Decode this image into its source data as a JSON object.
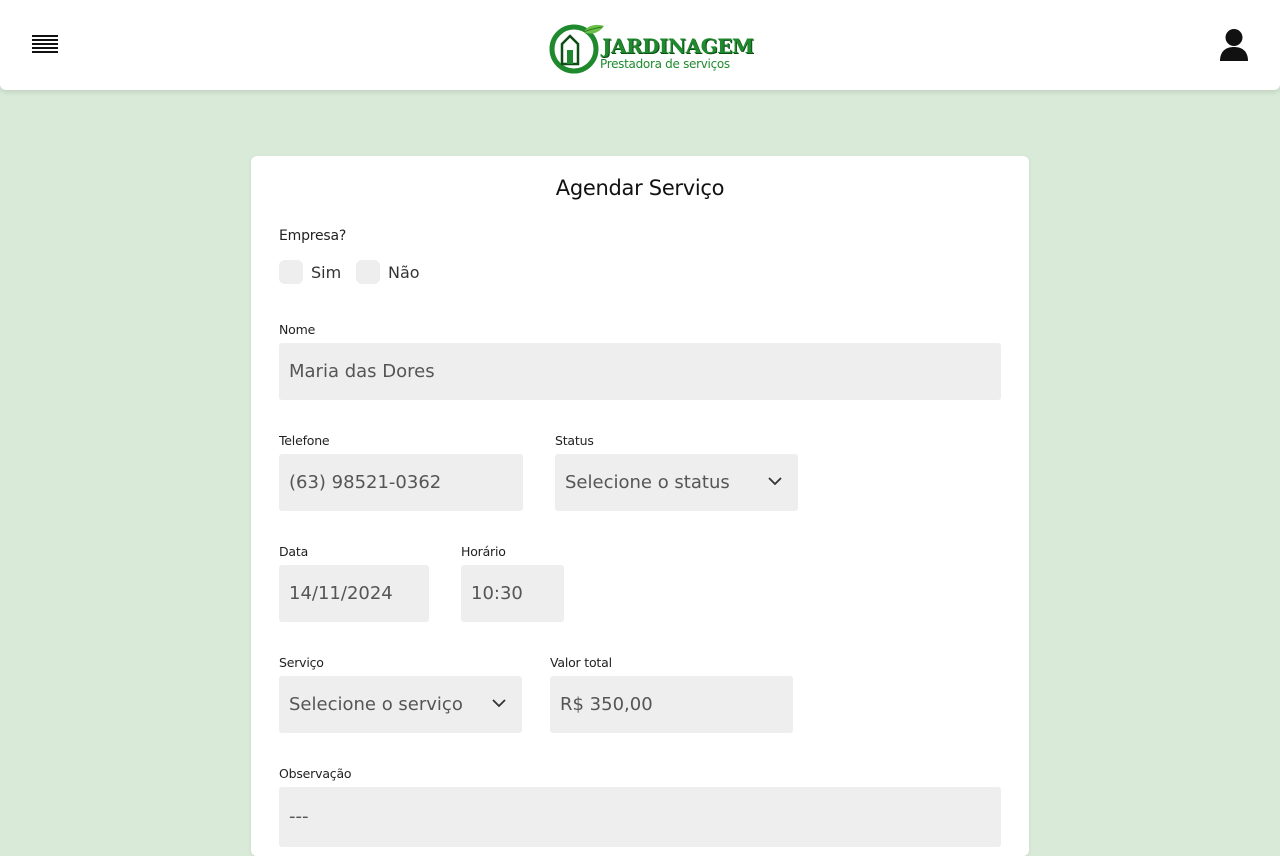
{
  "header": {
    "menu_icon": "hamburger-icon",
    "logo": {
      "title": "JARDINAGEM",
      "subtitle": "Prestadora de serviços",
      "brand_color": "#1f8a2d"
    },
    "user_icon": "user-icon"
  },
  "form": {
    "title": "Agendar Serviço",
    "empresa": {
      "label": "Empresa?",
      "options": [
        "Sim",
        "Não"
      ]
    },
    "nome": {
      "label": "Nome",
      "value": "Maria das Dores"
    },
    "telefone": {
      "label": "Telefone",
      "value": "(63) 98521-0362"
    },
    "status": {
      "label": "Status",
      "value": "Selecione o status"
    },
    "data": {
      "label": "Data",
      "value": "14/11/2024"
    },
    "horario": {
      "label": "Horário",
      "value": "10:30"
    },
    "servico": {
      "label": "Serviço",
      "value": "Selecione o serviço"
    },
    "valor_total": {
      "label": "Valor total",
      "value": "R$ 350,00"
    },
    "observacao": {
      "label": "Observação",
      "value": "---"
    }
  },
  "colors": {
    "background": "#d9ebd8",
    "card": "#ffffff",
    "field": "#eeeeee"
  }
}
